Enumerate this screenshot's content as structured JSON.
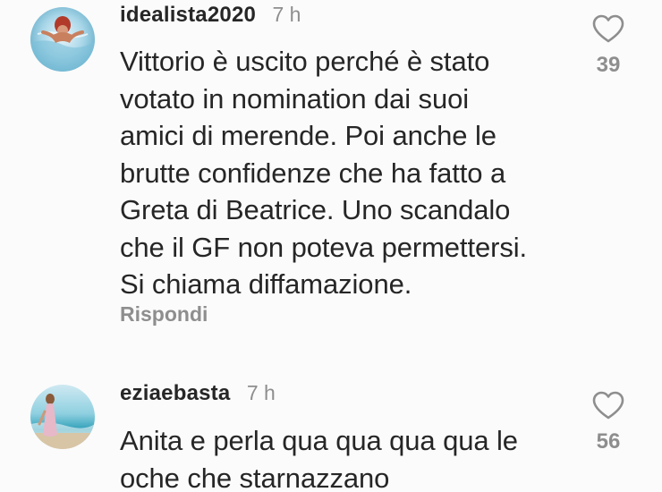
{
  "comments": [
    {
      "username": "idealista2020",
      "time": "7 h",
      "lines": [
        "Vittorio è uscito perché è stato",
        "votato in nomination dai suoi",
        "amici di merende. Poi anche le",
        "brutte confidenze che ha fatto a",
        "Greta di Beatrice. Uno scandalo",
        "che il GF non poteva permettersi.",
        "Si chiama diffamazione."
      ],
      "likes": "39",
      "reply_label": "Rispondi",
      "avatar_icon": "avatar-swimmer-icon"
    },
    {
      "username": "eziaebasta",
      "time": "7 h",
      "lines": [
        "Anita e perla qua qua qua qua le",
        "oche che starnazzano"
      ],
      "likes": "56",
      "avatar_icon": "avatar-beach-woman-icon"
    }
  ],
  "colors": {
    "text": "#262626",
    "secondary": "#8e8e8e",
    "background": "#fbfbfb"
  },
  "icons": {
    "like": "heart-outline-icon"
  }
}
